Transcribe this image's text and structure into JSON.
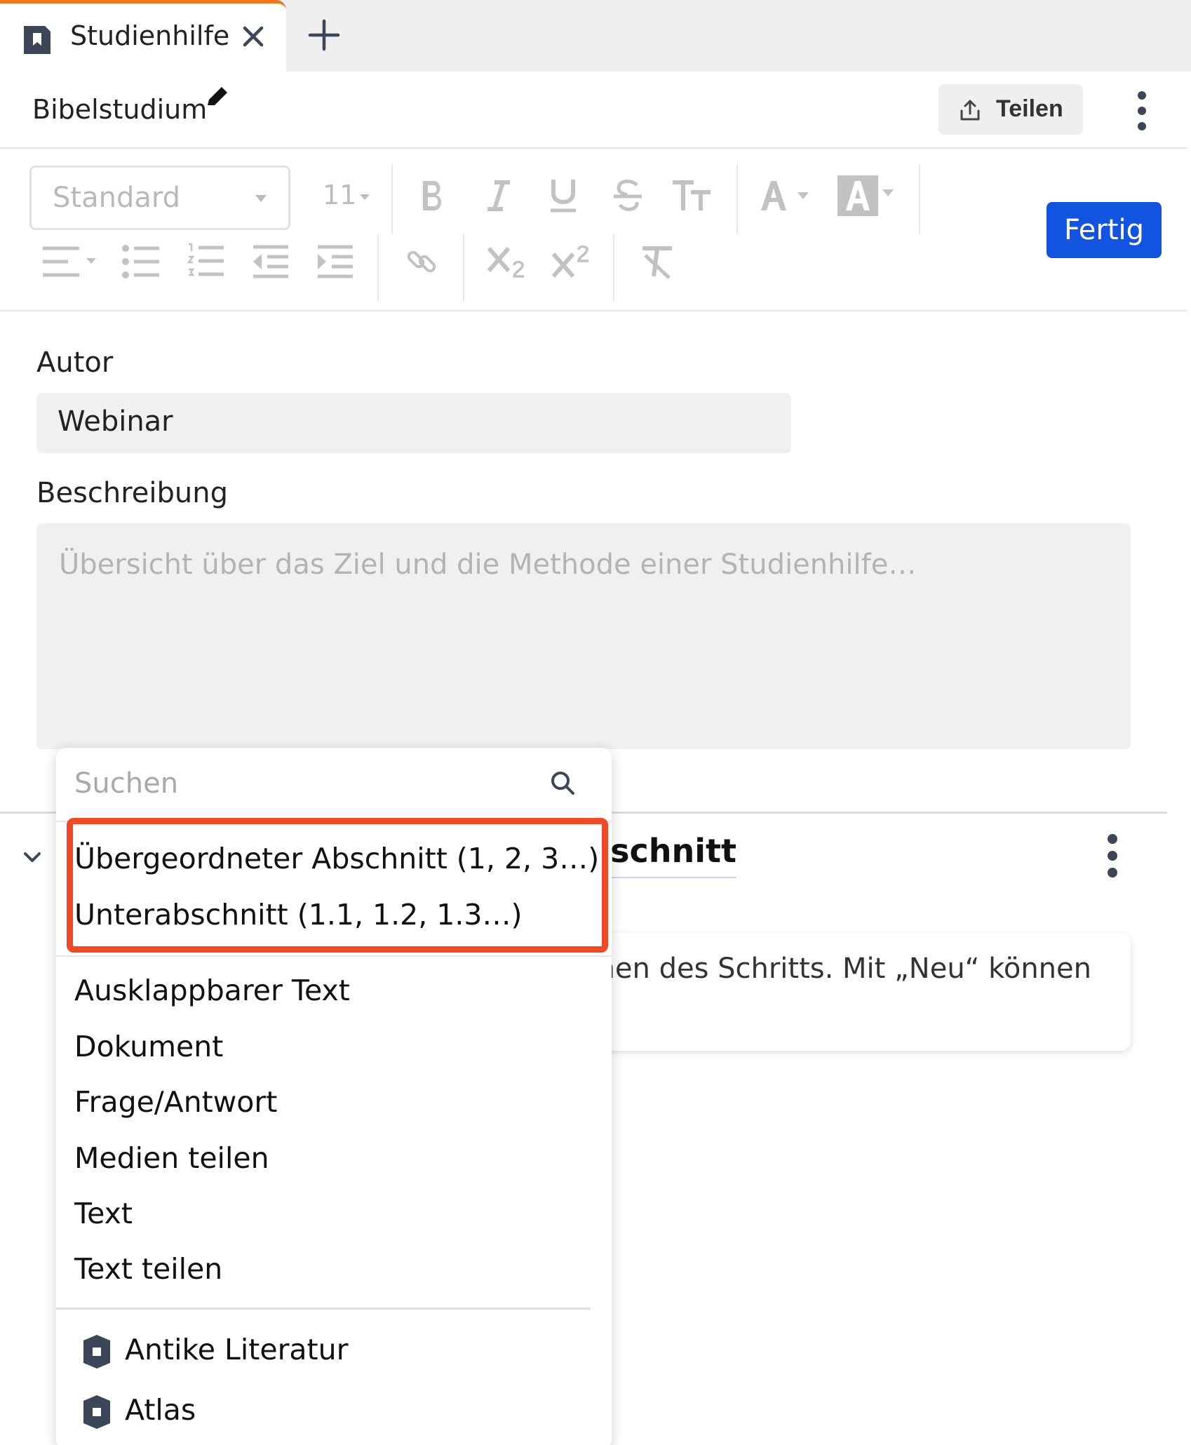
{
  "tabs": {
    "active_label": "Studienhilfe"
  },
  "header": {
    "title": "Bibelstudium",
    "share_label": "Teilen"
  },
  "toolbar": {
    "style_value": "Standard",
    "size_value": "11",
    "done_label": "Fertig",
    "done_color": "#1254e0"
  },
  "form": {
    "author_label": "Autor",
    "author_value": "Webinar",
    "description_label": "Beschreibung",
    "description_placeholder": "Übersicht über das Ziel und die Methode einer Studienhilfe…"
  },
  "section": {
    "title_visible": "bschnitt",
    "body_visible": "men des Schritts. Mit „Neu“ können"
  },
  "dropdown": {
    "search_placeholder": "Suchen",
    "highlighted_items": [
      "Übergeordneter Abschnitt (1, 2, 3…)",
      "Unterabschnitt (1.1, 1.2, 1.3…)"
    ],
    "items": [
      "Ausklappbarer Text",
      "Dokument",
      "Frage/Antwort",
      "Medien teilen",
      "Text",
      "Text teilen"
    ],
    "resource_items": [
      "Antike Literatur",
      "Atlas"
    ],
    "highlight_color": "#ef4a25"
  }
}
